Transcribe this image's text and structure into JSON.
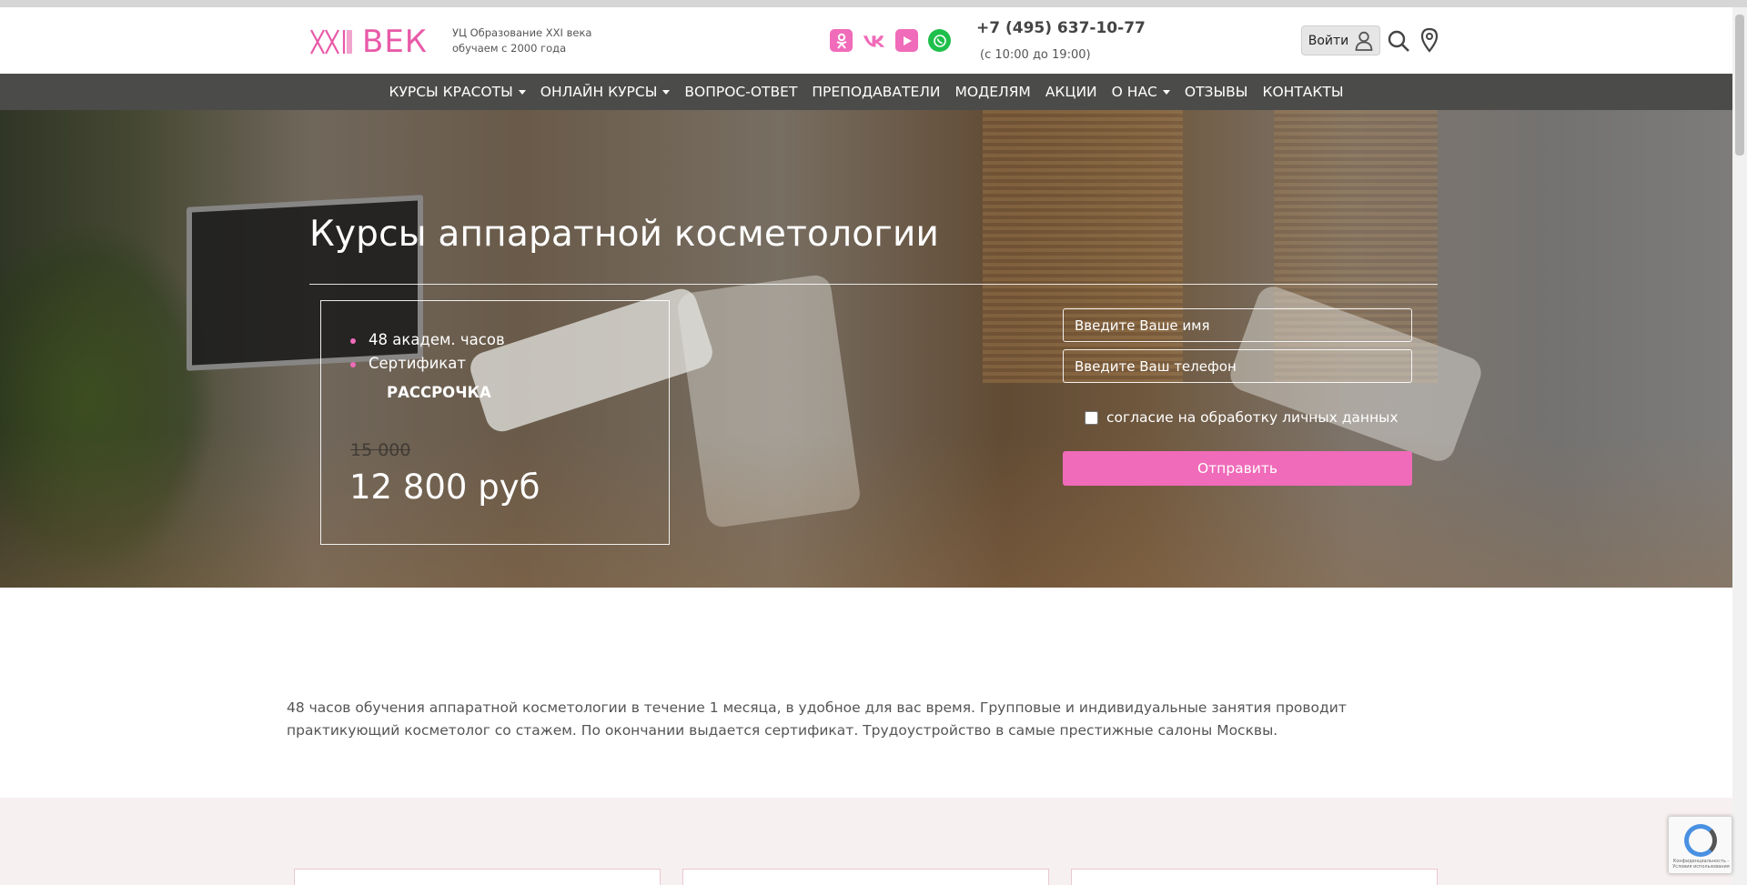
{
  "header": {
    "logo_text": "ВЕК",
    "tagline_line1": "УЦ Образование XXI века",
    "tagline_line2": "обучаем с 2000 года",
    "socials": [
      {
        "name": "odnoklassniki-icon",
        "glyph": "ок"
      },
      {
        "name": "vk-icon",
        "glyph": "vk"
      },
      {
        "name": "youtube-icon",
        "glyph": "▶"
      },
      {
        "name": "whatsapp-icon",
        "glyph": "✆"
      }
    ],
    "phone": "+7 (495) 637-10-77",
    "hours": "(с 10:00 до 19:00)",
    "login_label": "Войти"
  },
  "nav": {
    "items": [
      {
        "label": "КУРСЫ КРАСОТЫ",
        "dropdown": true
      },
      {
        "label": "ОНЛАЙН КУРСЫ",
        "dropdown": true
      },
      {
        "label": "ВОПРОС-ОТВЕТ",
        "dropdown": false
      },
      {
        "label": "ПРЕПОДАВАТЕЛИ",
        "dropdown": false
      },
      {
        "label": "МОДЕЛЯМ",
        "dropdown": false
      },
      {
        "label": "АКЦИИ",
        "dropdown": false
      },
      {
        "label": "О НАС",
        "dropdown": true
      },
      {
        "label": "ОТЗЫВЫ",
        "dropdown": false
      },
      {
        "label": "КОНТАКТЫ",
        "dropdown": false
      }
    ]
  },
  "hero": {
    "title": "Курсы аппаратной косметологии",
    "features": [
      "48 академ. часов",
      "Сертификат"
    ],
    "installment": "РАССРОЧКА",
    "old_price": "15 000",
    "new_price": "12 800 руб"
  },
  "form": {
    "name_placeholder": "Введите Ваше имя",
    "phone_placeholder": "Введите Ваш телефон",
    "consent_label": "согласие на обработку личных данных",
    "submit_label": "Отправить"
  },
  "description": "48 часов обучения аппаратной косметологии в течение 1 месяца, в удобное для вас время. Групповые и индивидуальные занятия проводит практикующий косметолог со стажем. По окончании выдается сертификат. Трудоустройство в самые престижные салоны Москвы.",
  "recaptcha": {
    "text": "Конфиденциальность - Условия использования"
  },
  "colors": {
    "accent": "#f06bb9",
    "nav_bg": "#4b4b49",
    "whatsapp": "#1fbf4b",
    "section_bg": "#f7f0f0"
  }
}
